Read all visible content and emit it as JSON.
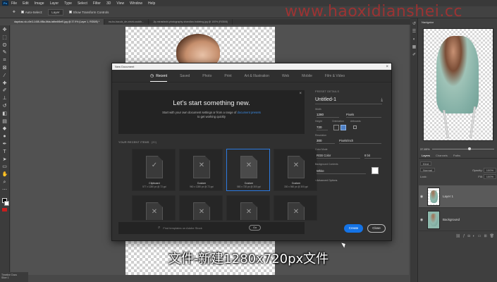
{
  "menubar": {
    "logo": "Ps",
    "items": [
      "File",
      "Edit",
      "Image",
      "Layer",
      "Type",
      "Select",
      "Filter",
      "3D",
      "View",
      "Window",
      "Help"
    ]
  },
  "optionsbar": {
    "auto_select": "Auto-Select:",
    "layer_select": "Layer",
    "show_transform": "Show Transform Controls"
  },
  "tabs": [
    "daychao-vk-c0e3-1408-4f8a-6fda-tafbe4f6ef0.jpg @ 37.9% (Layer 1, RGB/8) *",
    "ea-bu-baculz_de-crisht-couldh...",
    "Jip-mirasfashi-photography-shandlan-holdeing.jpg @ 100% (RGB/8)"
  ],
  "watermark": "www.haoxidianshei.cc",
  "navigator": {
    "title": "Navigator"
  },
  "zoom": {
    "value": "37.89%"
  },
  "layers_panel": {
    "tabs": [
      "Layers",
      "Channels",
      "Paths"
    ],
    "kind": "Kind",
    "blend_mode": "Normal",
    "opacity_label": "Opacity:",
    "opacity": "100%",
    "lock_label": "Lock:",
    "fill_label": "Fill:",
    "fill": "100%",
    "layers": [
      {
        "name": "Layer 1",
        "selected": true
      },
      {
        "name": "Background",
        "selected": false
      }
    ]
  },
  "statusbar": {
    "label": "Timeline Docs",
    "layer": "Slice 1"
  },
  "dialog": {
    "title": "New Document",
    "tabs": [
      "Recent",
      "Saved",
      "Photo",
      "Print",
      "Art & Illustration",
      "Web",
      "Mobile",
      "Film & Video"
    ],
    "active_tab": "Recent",
    "hero": {
      "title": "Let's start something new.",
      "line1_a": "Start with your own document settings or from a range of",
      "line1_link": "document presets",
      "line2": "to get working quickly"
    },
    "recent_label": "YOUR RECENT ITEMS",
    "recent_count": "(20)",
    "recent_items": [
      {
        "name": "Clipboard",
        "dim": "577 x 1280 px @ 72 ppi",
        "icon": "check",
        "selected": false
      },
      {
        "name": "Custom",
        "dim": "960 x 1280 px @ 72 ppi",
        "icon": "cross",
        "selected": false
      },
      {
        "name": "Custom",
        "dim": "580 x 720 px @ 300 ppi",
        "icon": "cross",
        "selected": true
      },
      {
        "name": "Custom",
        "dim": "330 x 560 px @ 300 ppi",
        "icon": "cross",
        "selected": false
      },
      {
        "name": "",
        "dim": "",
        "icon": "cross",
        "selected": false
      },
      {
        "name": "",
        "dim": "",
        "icon": "cross",
        "selected": false
      },
      {
        "name": "",
        "dim": "",
        "icon": "cross",
        "selected": false
      },
      {
        "name": "",
        "dim": "",
        "icon": "cross",
        "selected": false
      }
    ],
    "search_placeholder": "Find templates on Adobe Stock",
    "search_go": "Go",
    "details": {
      "header": "PRESET DETAILS",
      "doc_name": "Untitled-1",
      "width_label": "Width",
      "width": "1280",
      "width_unit": "Pixels",
      "height_label": "Height",
      "height": "720",
      "orientation_label": "Orientation",
      "artboards_label": "Artboards",
      "resolution_label": "Resolution",
      "resolution": "300",
      "resolution_unit": "Pixels/Inch",
      "color_mode_label": "Color Mode",
      "color_mode": "RGB Color",
      "bit_depth": "8 bit",
      "bg_label": "Background Contents",
      "bg_value": "White",
      "advanced": "Advanced Options"
    },
    "create_label": "Create",
    "close_label": "Close"
  },
  "subtitle": "文件-新建1280x720px文件",
  "colors": {
    "accent": "#1473e6",
    "watermark": "#e62828",
    "selected_border": "#2c7ae0"
  }
}
